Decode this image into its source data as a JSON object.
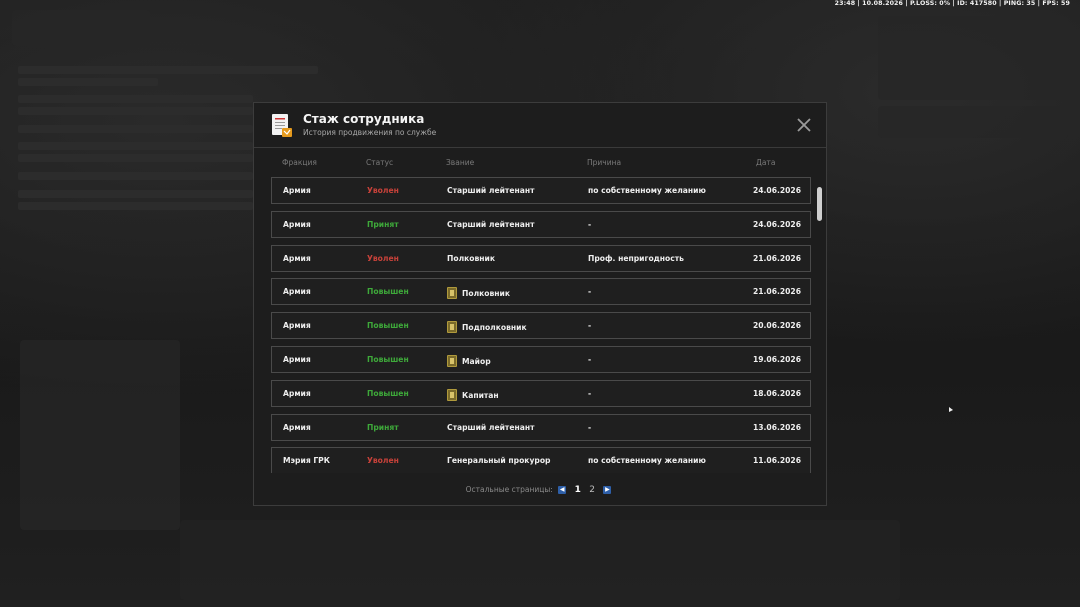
{
  "hud": {
    "status_line": "23:48 | 10.08.2026 | P.LOSS: 0% | ID: 417580 | PING: 35 | FPS: 59"
  },
  "modal": {
    "title": "Стаж сотрудника",
    "subtitle": "История продвижения по службе",
    "columns": [
      "Фракция",
      "Статус",
      "Звание",
      "Причина",
      "Дата"
    ],
    "rows": [
      {
        "faction": "Армия",
        "status": "Уволен",
        "status_color": "#c8423a",
        "rank": "Старший лейтенант",
        "rank_icon": false,
        "reason": "по собственному желанию",
        "date": "24.06.2026"
      },
      {
        "faction": "Армия",
        "status": "Принят",
        "status_color": "#3ea93a",
        "rank": "Старший лейтенант",
        "rank_icon": false,
        "reason": "-",
        "date": "24.06.2026"
      },
      {
        "faction": "Армия",
        "status": "Уволен",
        "status_color": "#c8423a",
        "rank": "Полковник",
        "rank_icon": false,
        "reason": "Проф. непригодность",
        "date": "21.06.2026"
      },
      {
        "faction": "Армия",
        "status": "Повышен",
        "status_color": "#3ea93a",
        "rank": "Полковник",
        "rank_icon": true,
        "reason": "-",
        "date": "21.06.2026"
      },
      {
        "faction": "Армия",
        "status": "Повышен",
        "status_color": "#3ea93a",
        "rank": "Подполковник",
        "rank_icon": true,
        "reason": "-",
        "date": "20.06.2026"
      },
      {
        "faction": "Армия",
        "status": "Повышен",
        "status_color": "#3ea93a",
        "rank": "Майор",
        "rank_icon": true,
        "reason": "-",
        "date": "19.06.2026"
      },
      {
        "faction": "Армия",
        "status": "Повышен",
        "status_color": "#3ea93a",
        "rank": "Капитан",
        "rank_icon": true,
        "reason": "-",
        "date": "18.06.2026"
      },
      {
        "faction": "Армия",
        "status": "Принят",
        "status_color": "#3ea93a",
        "rank": "Старший лейтенант",
        "rank_icon": false,
        "reason": "-",
        "date": "13.06.2026"
      },
      {
        "faction": "Мэрия ГРК",
        "status": "Уволен",
        "status_color": "#c8423a",
        "rank": "Генеральный прокурор",
        "rank_icon": false,
        "reason": "по собственному желанию",
        "date": "11.06.2026"
      }
    ],
    "pager": {
      "label": "Остальные страницы:",
      "pages": [
        "1",
        "2"
      ],
      "current": "1",
      "prev_icon": "chevron-left-icon",
      "next_icon": "chevron-right-icon"
    },
    "icons": {
      "header": "document-badge-icon",
      "close": "close-icon",
      "rank": "rank-insignia-icon"
    }
  }
}
